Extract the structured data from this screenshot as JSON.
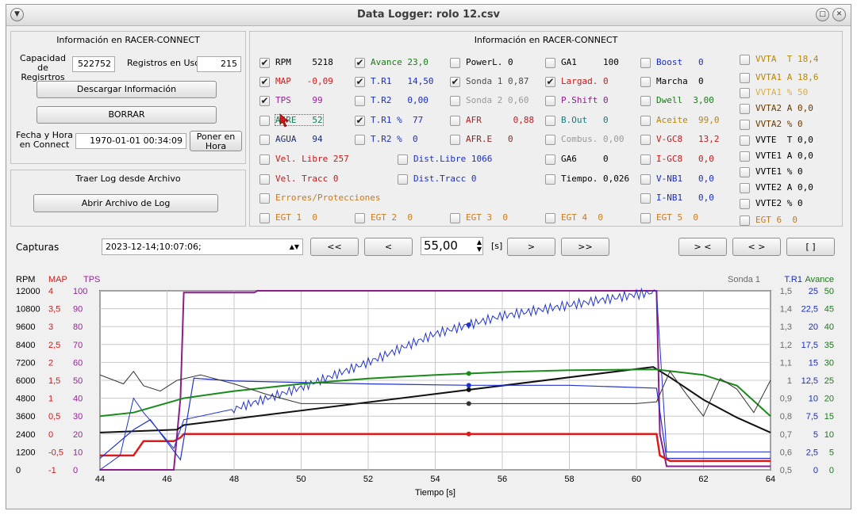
{
  "window": {
    "title": "Data Logger: rolo 12.csv"
  },
  "info_panel": {
    "title": "Información en RACER-CONNECT",
    "capacidad_label": "Capacidad de Regisrtros",
    "capacidad_value": "522752",
    "registros_label": "Registros en Uso",
    "registros_value": "215",
    "descargar_label": "Descargar Información",
    "borrar_label": "BORRAR",
    "fecha_label": "Fecha y Hora en Connect",
    "fecha_value": "1970-01-01 00:34:09",
    "poner_label": "Poner en Hora"
  },
  "log_panel": {
    "title": "Traer Log desde Archivo",
    "abrir_label": "Abrir Archivo de Log"
  },
  "channels_panel": {
    "title": "Información en RACER-CONNECT",
    "items": [
      {
        "text": "RPM    5218",
        "checked": true,
        "color": "#000000"
      },
      {
        "text": "Avance 23,0",
        "checked": true,
        "color": "#1a7a1a"
      },
      {
        "text": "PowerL. 0",
        "checked": false,
        "color": "#000000"
      },
      {
        "text": "GA1     100",
        "checked": false,
        "color": "#000000"
      },
      {
        "text": "Boost   0",
        "checked": false,
        "color": "#1a2ec0"
      },
      {
        "text": "VVTA  T 18,4",
        "checked": false,
        "color": "#b8860b"
      },
      {
        "text": "MAP   -0,09",
        "checked": true,
        "color": "#d11a1a"
      },
      {
        "text": "T.R1   14,50",
        "checked": true,
        "color": "#1a2ec0"
      },
      {
        "text": "Sonda 1 0,87",
        "checked": true,
        "color": "#4d4d4d"
      },
      {
        "text": "Largad. 0",
        "checked": true,
        "color": "#c41a1a"
      },
      {
        "text": "Marcha  0",
        "checked": false,
        "color": "#000000"
      },
      {
        "text": "VVTA1 A 18,6",
        "checked": false,
        "color": "#b8860b"
      },
      {
        "text": "TPS    99",
        "checked": true,
        "color": "#9a1f9a"
      },
      {
        "text": "T.R2   0,00",
        "checked": false,
        "color": "#1a2ec0"
      },
      {
        "text": "Sonda 2 0,60",
        "checked": false,
        "color": "#9a9a9a"
      },
      {
        "text": "P.Shift 0",
        "checked": false,
        "color": "#8a1f8a"
      },
      {
        "text": "Dwell  3,00",
        "checked": false,
        "color": "#1a7a1a"
      },
      {
        "text": "VVTA1 % 50",
        "checked": false,
        "color": "#d6b050"
      },
      {
        "text": "AIRE   52",
        "checked": false,
        "color": "#1a7a5a"
      },
      {
        "text": "T.R1 %  77",
        "checked": true,
        "color": "#1a2ec0"
      },
      {
        "text": "AFR      0,88",
        "checked": false,
        "color": "#c41a1a"
      },
      {
        "text": "B.Out   0",
        "checked": false,
        "color": "#1a7a7a"
      },
      {
        "text": "Aceite  99,0",
        "checked": false,
        "color": "#b8860b"
      },
      {
        "text": "VVTA2 A 0,0",
        "checked": false,
        "color": "#6a3a00"
      },
      {
        "text": "AGUA   94",
        "checked": false,
        "color": "#1a2e6a"
      },
      {
        "text": "T.R2 %  0",
        "checked": false,
        "color": "#1a2ec0"
      },
      {
        "text": "AFR.E   0",
        "checked": false,
        "color": "#8a1f1f"
      },
      {
        "text": "Combus. 0,00",
        "checked": false,
        "color": "#9a9a9a"
      },
      {
        "text": "V-GC8   13,2",
        "checked": false,
        "color": "#c41a1a"
      },
      {
        "text": "VVTA2 % 0",
        "checked": false,
        "color": "#6a3a00"
      },
      {
        "text": "Vel. Libre 257",
        "checked": false,
        "color": "#c41a1a"
      },
      {
        "text": "Dist.Libre 1066",
        "checked": false,
        "color": "#1a2ec0"
      },
      {
        "text": "GA6     0",
        "checked": false,
        "color": "#000000"
      },
      {
        "text": "I-GC8   0,0",
        "checked": false,
        "color": "#c41a1a"
      },
      {
        "text": "VVTE  T 0,0",
        "checked": false,
        "color": "#000000"
      },
      {
        "text": "Vel. Tracc 0",
        "checked": false,
        "color": "#c41a1a"
      },
      {
        "text": "Dist.Tracc 0",
        "checked": false,
        "color": "#1a2ec0"
      },
      {
        "text": "Tiempo. 0,026",
        "checked": false,
        "color": "#000000"
      },
      {
        "text": "V-NB1   0,0",
        "checked": false,
        "color": "#1a2ec0"
      },
      {
        "text": "VVTE1 A 0,0",
        "checked": false,
        "color": "#000000"
      },
      {
        "text": "Errores/Protecciones",
        "checked": false,
        "color": "#c97a1a"
      },
      {
        "text": "I-NB1   0,0",
        "checked": false,
        "color": "#1a2ec0"
      },
      {
        "text": "VVTE1 % 0",
        "checked": false,
        "color": "#000000"
      },
      {
        "text": "VVTE2 A 0,0",
        "checked": false,
        "color": "#000000"
      },
      {
        "text": "VVTE2 % 0",
        "checked": false,
        "color": "#000000"
      },
      {
        "text": "EGT 1  0",
        "checked": false,
        "color": "#c97a1a"
      },
      {
        "text": "EGT 2  0",
        "checked": false,
        "color": "#c97a1a"
      },
      {
        "text": "EGT 3  0",
        "checked": false,
        "color": "#c97a1a"
      },
      {
        "text": "EGT 4  0",
        "checked": false,
        "color": "#c97a1a"
      },
      {
        "text": "EGT 5  0",
        "checked": false,
        "color": "#c97a1a"
      },
      {
        "text": "EGT 6  0",
        "checked": false,
        "color": "#c97a1a"
      }
    ]
  },
  "capturas": {
    "label": "Capturas",
    "selected": "2023-12-14;10:07:06;",
    "btn_first": "<<",
    "btn_prev": "<",
    "window_value": "55,00",
    "unit": "[s]",
    "btn_next": ">",
    "btn_last": ">>",
    "btn_zoom_in": "> <",
    "btn_zoom_out": "< >",
    "btn_full": "[ ]"
  },
  "chart_data": {
    "type": "line",
    "xlabel": "Tiempo [s]",
    "xlim": [
      44,
      64
    ],
    "x_ticks": [
      "44",
      "46",
      "48",
      "50",
      "52",
      "54",
      "56",
      "58",
      "60",
      "62",
      "64"
    ],
    "left_axes": [
      {
        "name": "RPM",
        "color": "#000000",
        "ticks": [
          "12000",
          "10800",
          "9600",
          "8400",
          "7200",
          "6000",
          "4800",
          "3600",
          "2400",
          "1200",
          "0"
        ],
        "ylim": [
          0,
          12000
        ]
      },
      {
        "name": "MAP",
        "color": "#d11a1a",
        "ticks": [
          "4",
          "3,5",
          "3",
          "2,5",
          "2",
          "1,5",
          "1",
          "0,5",
          "0",
          "-0,5",
          "-1"
        ],
        "ylim": [
          -1,
          4
        ]
      },
      {
        "name": "TPS",
        "color": "#9a1f9a",
        "ticks": [
          "100",
          "90",
          "80",
          "70",
          "60",
          "50",
          "40",
          "30",
          "20",
          "10",
          "0"
        ],
        "ylim": [
          0,
          100
        ]
      }
    ],
    "right_axes": [
      {
        "name": "Sonda 1",
        "color": "#6a6a6a",
        "ticks": [
          "1,5",
          "1,4",
          "1,3",
          "1,2",
          "1,1",
          "1",
          "0,9",
          "0,8",
          "0,7",
          "0,6",
          "0,5"
        ],
        "ylim": [
          0.5,
          1.5
        ]
      },
      {
        "name": "T.R1",
        "color": "#1a2ec0",
        "ticks": [
          "25",
          "22,5",
          "20",
          "17,5",
          "15",
          "12,5",
          "10",
          "7,5",
          "5",
          "2,5",
          "0"
        ],
        "ylim": [
          0,
          25
        ]
      },
      {
        "name": "Avance",
        "color": "#1a7a1a",
        "ticks": [
          "50",
          "45",
          "40",
          "35",
          "30",
          "25",
          "20",
          "15",
          "10",
          "5",
          "0"
        ],
        "ylim": [
          0,
          50
        ]
      }
    ],
    "cursor_x": 55,
    "series": [
      {
        "name": "TPS",
        "color": "#8a1f8a",
        "x": [
          44,
          46.2,
          46.4,
          46.5,
          48.6,
          48.7,
          60.6,
          60.7,
          60.9,
          64
        ],
        "y": [
          0,
          0,
          40,
          99,
          99,
          100,
          100,
          20,
          2,
          2
        ]
      },
      {
        "name": "MAP",
        "color": "#e01a1a",
        "x": [
          44,
          45,
          45.3,
          46.2,
          46.4,
          46.5,
          60.6,
          60.7,
          61,
          64
        ],
        "y": [
          -0.6,
          -0.6,
          -0.2,
          -0.2,
          -0.1,
          0,
          0,
          -0.6,
          -0.75,
          -0.75
        ]
      },
      {
        "name": "RPM",
        "color": "#111111",
        "x": [
          44,
          46.3,
          46.5,
          60.5,
          61,
          62,
          63,
          64
        ],
        "y": [
          2500,
          2700,
          3000,
          6900,
          6200,
          4700,
          3500,
          2500
        ]
      },
      {
        "name": "T.R1",
        "color": "#2233cc",
        "x": [
          44,
          44.6,
          45,
          45.3,
          46.2,
          46.5,
          48,
          50,
          52,
          54,
          56,
          58,
          60,
          60.6,
          60.9,
          64
        ],
        "y": [
          0,
          2,
          10,
          8,
          3,
          7,
          8.5,
          11.5,
          15,
          19,
          21.5,
          23,
          24.5,
          24.8,
          2.5,
          2.5
        ]
      },
      {
        "name": "T.R1 %",
        "color": "#2233cc",
        "x": [
          44,
          45,
          45.5,
          46.4,
          46.8,
          48,
          52,
          55,
          58,
          60.6,
          60.9,
          64
        ],
        "y": [
          0.8,
          2.8,
          3.5,
          0.7,
          6.4,
          6.2,
          6.0,
          5.9,
          5.9,
          5.7,
          0.8,
          0.8
        ]
      },
      {
        "name": "Avance",
        "color": "#1a8a1a",
        "x": [
          44,
          45,
          46.5,
          48,
          50,
          52,
          54,
          56,
          58,
          60,
          60.6,
          62,
          63,
          64
        ],
        "y": [
          15,
          16,
          20,
          22,
          24,
          25.5,
          26.5,
          27.3,
          27.8,
          28,
          28,
          26.5,
          23.5,
          15
        ]
      },
      {
        "name": "Sonda 1",
        "color": "#333333",
        "x": [
          44,
          44.7,
          45,
          45.3,
          45.8,
          46.3,
          47,
          48,
          49,
          50,
          52,
          54,
          56,
          58,
          60,
          60.6,
          61,
          61.5,
          62,
          62.5,
          63,
          63.5,
          64
        ],
        "y": [
          1.03,
          0.98,
          1.05,
          0.97,
          0.94,
          1.0,
          1.03,
          0.98,
          0.92,
          0.87,
          0.87,
          0.87,
          0.87,
          0.87,
          0.87,
          0.88,
          1.05,
          0.92,
          0.8,
          1.01,
          0.95,
          0.82,
          1.0
        ]
      }
    ]
  }
}
